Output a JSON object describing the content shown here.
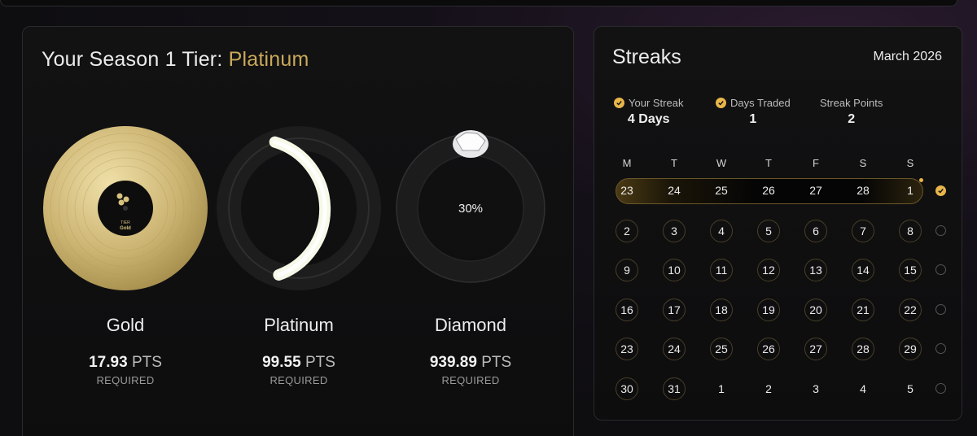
{
  "tier": {
    "title_prefix": "Your Season 1 Tier:",
    "current": "Platinum",
    "items": [
      {
        "name": "Gold",
        "pts": "17.93",
        "unit": "PTS",
        "req": "REQUIRED",
        "record_brand": "TIER",
        "record_label": "Gold"
      },
      {
        "name": "Platinum",
        "pts": "99.55",
        "unit": "PTS",
        "req": "REQUIRED"
      },
      {
        "name": "Diamond",
        "pts": "939.89",
        "unit": "PTS",
        "req": "REQUIRED",
        "progress_label": "30%",
        "progress": 0.3
      }
    ]
  },
  "streaks": {
    "title": "Streaks",
    "month": "March 2026",
    "stats": [
      {
        "label": "Your Streak",
        "value": "4 Days",
        "checked": true
      },
      {
        "label": "Days Traded",
        "value": "1",
        "checked": true
      },
      {
        "label": "Streak Points",
        "value": "2",
        "checked": false
      }
    ],
    "days_of_week": [
      "M",
      "T",
      "W",
      "T",
      "F",
      "S",
      "S"
    ],
    "weeks": [
      {
        "days": [
          "23",
          "24",
          "25",
          "26",
          "27",
          "28",
          "1"
        ],
        "complete": true
      },
      {
        "days": [
          "2",
          "3",
          "4",
          "5",
          "6",
          "7",
          "8"
        ],
        "complete": false
      },
      {
        "days": [
          "9",
          "10",
          "11",
          "12",
          "13",
          "14",
          "15"
        ],
        "complete": false
      },
      {
        "days": [
          "16",
          "17",
          "18",
          "19",
          "20",
          "21",
          "22"
        ],
        "complete": false
      },
      {
        "days": [
          "23",
          "24",
          "25",
          "26",
          "27",
          "28",
          "29"
        ],
        "complete": false
      },
      {
        "days": [
          "30",
          "31",
          "1",
          "2",
          "3",
          "4",
          "5"
        ],
        "complete": false
      }
    ],
    "colors": {
      "accent": "#e8b64a",
      "gold_text": "#c9a95a"
    }
  }
}
